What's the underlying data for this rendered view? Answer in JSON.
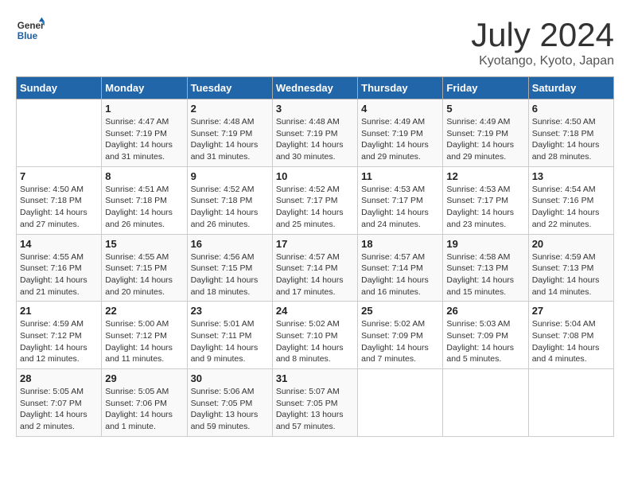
{
  "header": {
    "logo_line1": "General",
    "logo_line2": "Blue",
    "month_year": "July 2024",
    "location": "Kyotango, Kyoto, Japan"
  },
  "days_of_week": [
    "Sunday",
    "Monday",
    "Tuesday",
    "Wednesday",
    "Thursday",
    "Friday",
    "Saturday"
  ],
  "weeks": [
    [
      {
        "day": "",
        "info": ""
      },
      {
        "day": "1",
        "info": "Sunrise: 4:47 AM\nSunset: 7:19 PM\nDaylight: 14 hours\nand 31 minutes."
      },
      {
        "day": "2",
        "info": "Sunrise: 4:48 AM\nSunset: 7:19 PM\nDaylight: 14 hours\nand 31 minutes."
      },
      {
        "day": "3",
        "info": "Sunrise: 4:48 AM\nSunset: 7:19 PM\nDaylight: 14 hours\nand 30 minutes."
      },
      {
        "day": "4",
        "info": "Sunrise: 4:49 AM\nSunset: 7:19 PM\nDaylight: 14 hours\nand 29 minutes."
      },
      {
        "day": "5",
        "info": "Sunrise: 4:49 AM\nSunset: 7:19 PM\nDaylight: 14 hours\nand 29 minutes."
      },
      {
        "day": "6",
        "info": "Sunrise: 4:50 AM\nSunset: 7:18 PM\nDaylight: 14 hours\nand 28 minutes."
      }
    ],
    [
      {
        "day": "7",
        "info": "Sunrise: 4:50 AM\nSunset: 7:18 PM\nDaylight: 14 hours\nand 27 minutes."
      },
      {
        "day": "8",
        "info": "Sunrise: 4:51 AM\nSunset: 7:18 PM\nDaylight: 14 hours\nand 26 minutes."
      },
      {
        "day": "9",
        "info": "Sunrise: 4:52 AM\nSunset: 7:18 PM\nDaylight: 14 hours\nand 26 minutes."
      },
      {
        "day": "10",
        "info": "Sunrise: 4:52 AM\nSunset: 7:17 PM\nDaylight: 14 hours\nand 25 minutes."
      },
      {
        "day": "11",
        "info": "Sunrise: 4:53 AM\nSunset: 7:17 PM\nDaylight: 14 hours\nand 24 minutes."
      },
      {
        "day": "12",
        "info": "Sunrise: 4:53 AM\nSunset: 7:17 PM\nDaylight: 14 hours\nand 23 minutes."
      },
      {
        "day": "13",
        "info": "Sunrise: 4:54 AM\nSunset: 7:16 PM\nDaylight: 14 hours\nand 22 minutes."
      }
    ],
    [
      {
        "day": "14",
        "info": "Sunrise: 4:55 AM\nSunset: 7:16 PM\nDaylight: 14 hours\nand 21 minutes."
      },
      {
        "day": "15",
        "info": "Sunrise: 4:55 AM\nSunset: 7:15 PM\nDaylight: 14 hours\nand 20 minutes."
      },
      {
        "day": "16",
        "info": "Sunrise: 4:56 AM\nSunset: 7:15 PM\nDaylight: 14 hours\nand 18 minutes."
      },
      {
        "day": "17",
        "info": "Sunrise: 4:57 AM\nSunset: 7:14 PM\nDaylight: 14 hours\nand 17 minutes."
      },
      {
        "day": "18",
        "info": "Sunrise: 4:57 AM\nSunset: 7:14 PM\nDaylight: 14 hours\nand 16 minutes."
      },
      {
        "day": "19",
        "info": "Sunrise: 4:58 AM\nSunset: 7:13 PM\nDaylight: 14 hours\nand 15 minutes."
      },
      {
        "day": "20",
        "info": "Sunrise: 4:59 AM\nSunset: 7:13 PM\nDaylight: 14 hours\nand 14 minutes."
      }
    ],
    [
      {
        "day": "21",
        "info": "Sunrise: 4:59 AM\nSunset: 7:12 PM\nDaylight: 14 hours\nand 12 minutes."
      },
      {
        "day": "22",
        "info": "Sunrise: 5:00 AM\nSunset: 7:12 PM\nDaylight: 14 hours\nand 11 minutes."
      },
      {
        "day": "23",
        "info": "Sunrise: 5:01 AM\nSunset: 7:11 PM\nDaylight: 14 hours\nand 9 minutes."
      },
      {
        "day": "24",
        "info": "Sunrise: 5:02 AM\nSunset: 7:10 PM\nDaylight: 14 hours\nand 8 minutes."
      },
      {
        "day": "25",
        "info": "Sunrise: 5:02 AM\nSunset: 7:09 PM\nDaylight: 14 hours\nand 7 minutes."
      },
      {
        "day": "26",
        "info": "Sunrise: 5:03 AM\nSunset: 7:09 PM\nDaylight: 14 hours\nand 5 minutes."
      },
      {
        "day": "27",
        "info": "Sunrise: 5:04 AM\nSunset: 7:08 PM\nDaylight: 14 hours\nand 4 minutes."
      }
    ],
    [
      {
        "day": "28",
        "info": "Sunrise: 5:05 AM\nSunset: 7:07 PM\nDaylight: 14 hours\nand 2 minutes."
      },
      {
        "day": "29",
        "info": "Sunrise: 5:05 AM\nSunset: 7:06 PM\nDaylight: 14 hours\nand 1 minute."
      },
      {
        "day": "30",
        "info": "Sunrise: 5:06 AM\nSunset: 7:05 PM\nDaylight: 13 hours\nand 59 minutes."
      },
      {
        "day": "31",
        "info": "Sunrise: 5:07 AM\nSunset: 7:05 PM\nDaylight: 13 hours\nand 57 minutes."
      },
      {
        "day": "",
        "info": ""
      },
      {
        "day": "",
        "info": ""
      },
      {
        "day": "",
        "info": ""
      }
    ]
  ]
}
